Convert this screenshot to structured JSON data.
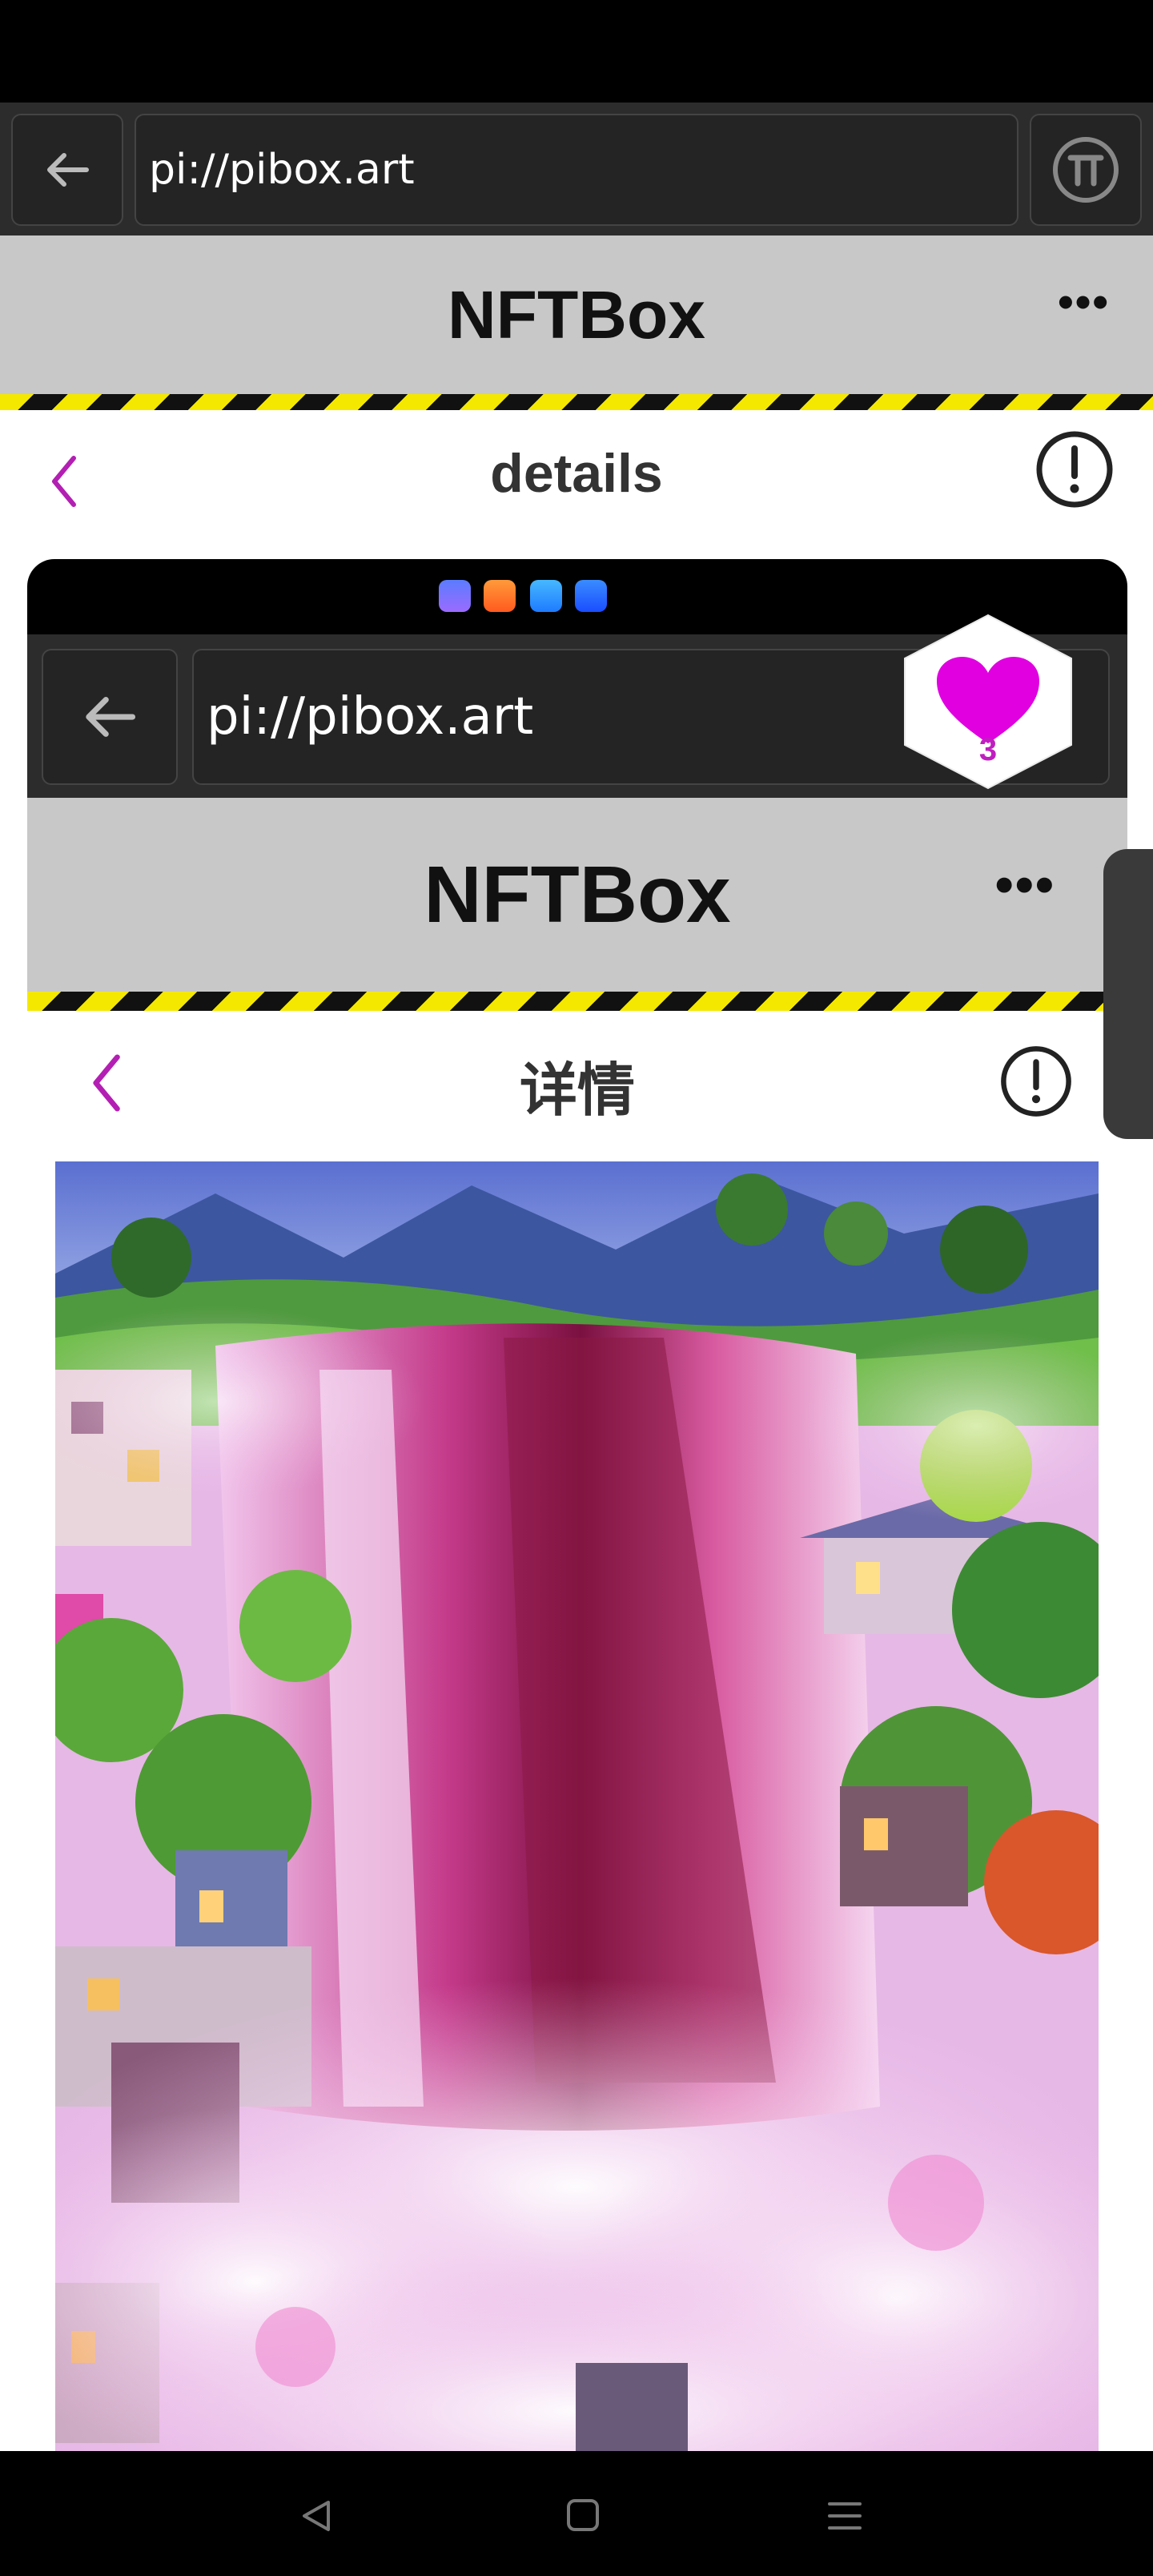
{
  "browser": {
    "url": "pi://pibox.art",
    "back_icon": "arrow-left-icon",
    "pi_icon": "pi-logo-icon"
  },
  "app": {
    "title": "NFTBox",
    "menu_label": "•••"
  },
  "page": {
    "title": "details",
    "back_icon": "chevron-left-icon",
    "info_icon": "alert-circle-icon"
  },
  "inner": {
    "url": "pi://pibox.art",
    "app_title": "NFTBox",
    "menu_label": "•••",
    "page_title": "详情",
    "status_app_icons": [
      "music-app-icon",
      "video-app-icon",
      "cloud-app-icon",
      "tips-app-icon"
    ]
  },
  "like": {
    "count": "3",
    "color": "#e000e0"
  },
  "accent_color": "#b31fb3"
}
